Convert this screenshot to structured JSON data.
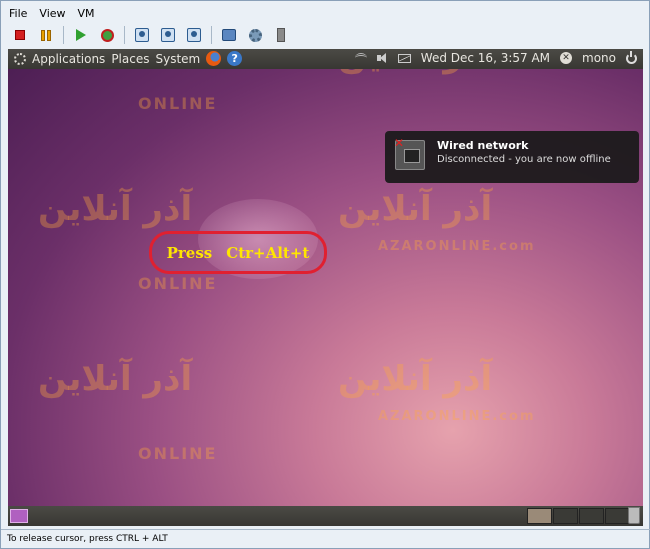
{
  "host": {
    "menu": [
      "File",
      "View",
      "VM"
    ],
    "status_text": "To release cursor, press CTRL + ALT"
  },
  "toolbar": {
    "icons": [
      "stop-icon",
      "pause-icon",
      "play-icon",
      "reset-icon",
      "snapshot-icon",
      "revert-snapshot-icon",
      "manage-snapshots-icon",
      "fullscreen-icon",
      "settings-icon",
      "usb-icon"
    ]
  },
  "guest": {
    "panel": {
      "applications": "Applications",
      "places": "Places",
      "system": "System",
      "datetime": "Wed Dec 16,  3:57 AM",
      "user": "mono"
    },
    "notification": {
      "title": "Wired network",
      "body": "Disconnected - you are now offline"
    },
    "annotation": {
      "word1": "Press",
      "word2": "Ctr+Alt+t"
    },
    "watermark": {
      "arabic": "آذر آنلاین",
      "latin": "ONLINE",
      "domain": "AZARONLINE.com"
    }
  },
  "colors": {
    "annotation_border": "#e02030",
    "annotation_text": "#ffe600",
    "panel": "#3f3e3a"
  }
}
